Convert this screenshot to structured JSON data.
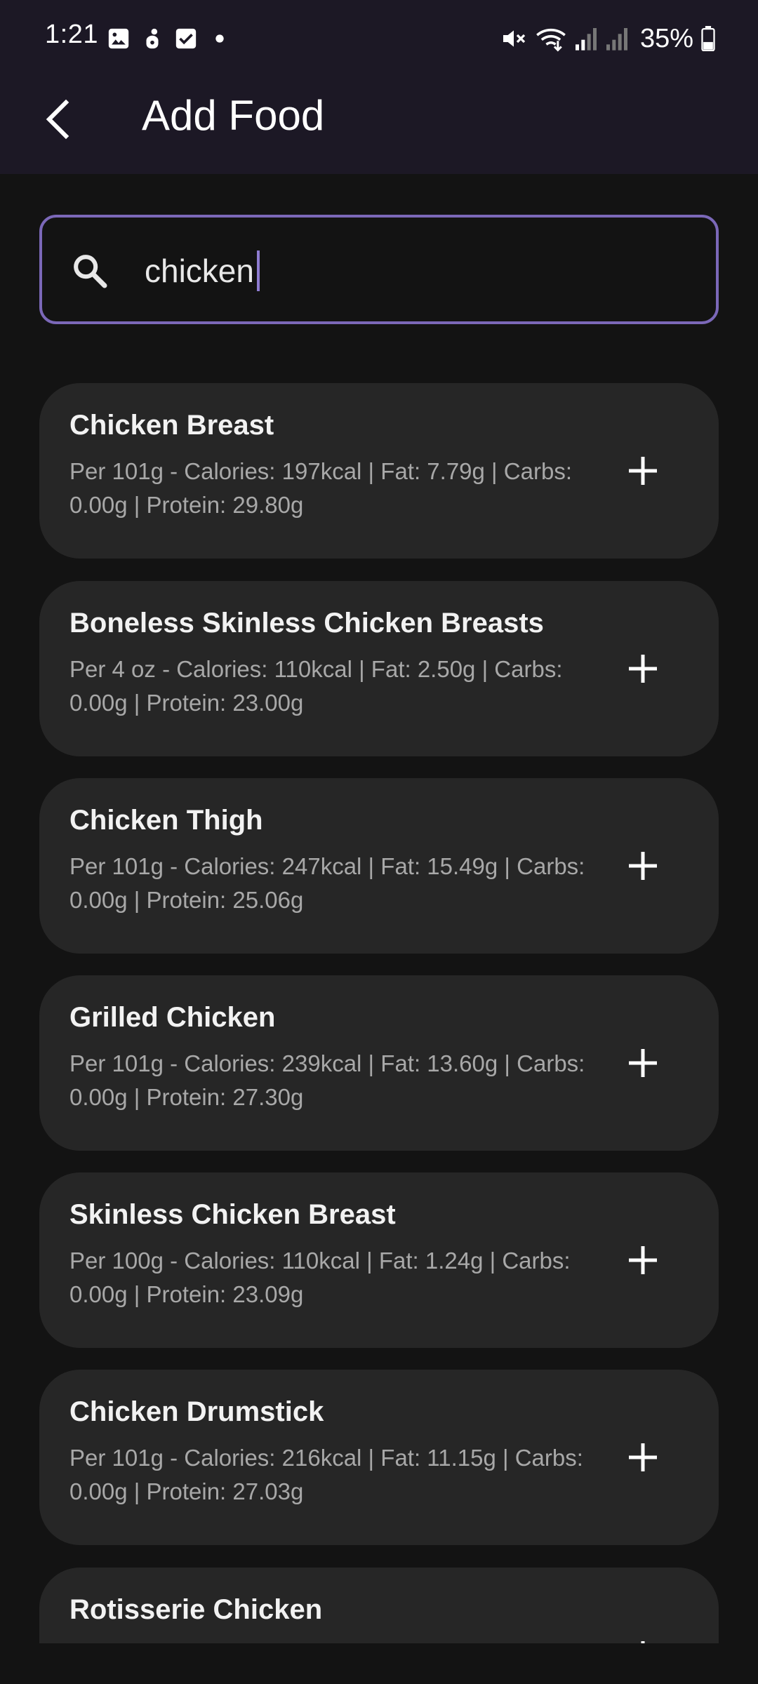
{
  "status_bar": {
    "time": "1:21",
    "battery_percent": "35%",
    "left_icons": [
      "gallery-icon",
      "hand-icon",
      "checkbox-icon",
      "dot-icon"
    ],
    "right_icons": [
      "mute-icon",
      "wifi-icon",
      "signal-icon",
      "signal-icon",
      "battery-icon"
    ]
  },
  "header": {
    "title": "Add Food",
    "back_icon": "arrow-back-icon"
  },
  "search": {
    "value": "chicken",
    "icon": "search-icon",
    "accent_color": "#7b68b8"
  },
  "results": [
    {
      "name": "Chicken Breast",
      "details": "Per 101g - Calories: 197kcal | Fat: 7.79g | Carbs: 0.00g | Protein: 29.80g"
    },
    {
      "name": "Boneless Skinless Chicken Breasts",
      "details": "Per 4 oz - Calories: 110kcal | Fat: 2.50g | Carbs: 0.00g | Protein: 23.00g"
    },
    {
      "name": "Chicken Thigh",
      "details": "Per 101g - Calories: 247kcal | Fat: 15.49g | Carbs: 0.00g | Protein: 25.06g"
    },
    {
      "name": "Grilled Chicken",
      "details": "Per 101g - Calories: 239kcal | Fat: 13.60g | Carbs: 0.00g | Protein: 27.30g"
    },
    {
      "name": "Skinless Chicken Breast",
      "details": "Per 100g - Calories: 110kcal | Fat: 1.24g | Carbs: 0.00g | Protein: 23.09g"
    },
    {
      "name": "Chicken Drumstick",
      "details": "Per 101g - Calories: 216kcal | Fat: 11.15g | Carbs: 0.00g | Protein: 27.03g"
    },
    {
      "name": "Rotisserie Chicken",
      "details": ""
    }
  ],
  "colors": {
    "background": "#131313",
    "app_bar": "#1c1825",
    "card": "#262626",
    "secondary_text": "#a8a8a8"
  }
}
